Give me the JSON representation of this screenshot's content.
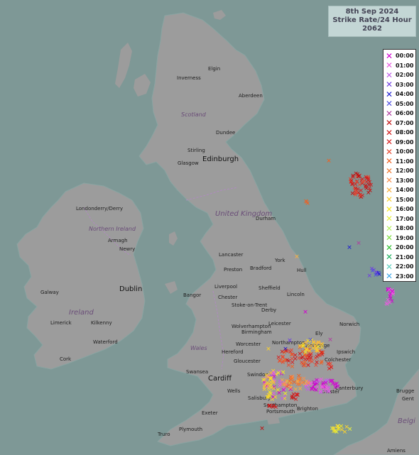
{
  "info": {
    "date": "8th Sep 2024",
    "title": "Strike Rate/24 Hour",
    "count": "2062"
  },
  "legend": {
    "items": [
      {
        "label": "00:00",
        "color": "#d000d0"
      },
      {
        "label": "01:00",
        "color": "#e85de0"
      },
      {
        "label": "02:00",
        "color": "#c060e8"
      },
      {
        "label": "03:00",
        "color": "#7040e0"
      },
      {
        "label": "04:00",
        "color": "#2020d0"
      },
      {
        "label": "05:00",
        "color": "#5050e0"
      },
      {
        "label": "06:00",
        "color": "#b040a0"
      },
      {
        "label": "07:00",
        "color": "#c01010"
      },
      {
        "label": "08:00",
        "color": "#d01818"
      },
      {
        "label": "09:00",
        "color": "#d82020"
      },
      {
        "label": "10:00",
        "color": "#e84830"
      },
      {
        "label": "11:00",
        "color": "#f06020"
      },
      {
        "label": "12:00",
        "color": "#f07830"
      },
      {
        "label": "13:00",
        "color": "#f89050"
      },
      {
        "label": "14:00",
        "color": "#f8b040"
      },
      {
        "label": "15:00",
        "color": "#f8d030"
      },
      {
        "label": "16:00",
        "color": "#f8e820"
      },
      {
        "label": "17:00",
        "color": "#e8f040"
      },
      {
        "label": "18:00",
        "color": "#b8f060"
      },
      {
        "label": "19:00",
        "color": "#80e040"
      },
      {
        "label": "20:00",
        "color": "#30c030"
      },
      {
        "label": "21:00",
        "color": "#20b060"
      },
      {
        "label": "22:00",
        "color": "#60d0c0"
      },
      {
        "label": "23:00",
        "color": "#40a8e8"
      }
    ]
  },
  "regions": {
    "scotland": "Scotland",
    "united_kingdom": "United Kingdom",
    "northern_ireland": "Northern Ireland",
    "ireland": "Ireland",
    "wales": "Wales",
    "belgie": "Belgi"
  },
  "places": {
    "elgin": "Elgin",
    "inverness": "Inverness",
    "aberdeen": "Aberdeen",
    "dundee": "Dundee",
    "stirling": "Stirling",
    "edinburgh": "Edinburgh",
    "glasgow": "Glasgow",
    "londonderry": "Londonderry/Derry",
    "armagh": "Armagh",
    "newry": "Newry",
    "durham": "Durham",
    "york": "York",
    "lancaster": "Lancaster",
    "preston": "Preston",
    "bradford": "Bradford",
    "hull": "Hull",
    "liverpool": "Liverpool",
    "sheffield": "Sheffield",
    "bangor": "Bangor",
    "chester": "Chester",
    "lincoln": "Lincoln",
    "galway": "Galway",
    "dublin": "Dublin",
    "stoke": "Stoke-on-Trent",
    "derby": "Derby",
    "limerick": "Limerick",
    "kilkenny": "Kilkenny",
    "wolverhampton": "Wolverhampton",
    "leicester": "Leicester",
    "norwich": "Norwich",
    "birmingham": "Birmingham",
    "ely": "Ely",
    "waterford": "Waterford",
    "worcester": "Worcester",
    "northampton": "Northampton",
    "cambridge": "Cambridge",
    "hereford": "Hereford",
    "ipswich": "Ipswich",
    "cork": "Cork",
    "gloucester": "Gloucester",
    "colchester": "Colchester",
    "swansea": "Swansea",
    "swindon": "Swindon",
    "cardiff": "Cardiff",
    "canterbury": "Canterbury",
    "wells": "Wells",
    "salisbury": "Salisbury",
    "southampton": "Southampton",
    "brighton": "Brighton",
    "portsmouth": "Portsmouth",
    "exeter": "Exeter",
    "plymouth": "Plymouth",
    "truro": "Truro",
    "brugge": "Brugge",
    "gent": "Gent",
    "amiens": "Amiens",
    "manchester": "chester"
  }
}
